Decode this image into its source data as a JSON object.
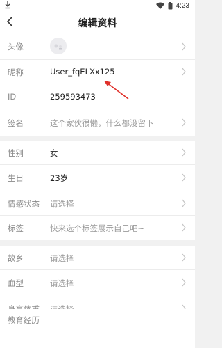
{
  "status_bar": {
    "time": "4:23"
  },
  "header": {
    "title": "编辑资料"
  },
  "rows": [
    {
      "label": "头像",
      "value": ""
    },
    {
      "label": "昵称",
      "value": "User_fqELXx125"
    },
    {
      "label": "ID",
      "value": "259593473"
    },
    {
      "label": "签名",
      "value": "这个家伙很懒，什么都没留下"
    },
    {
      "label": "性别",
      "value": "女"
    },
    {
      "label": "生日",
      "value": "23岁"
    },
    {
      "label": "情感状态",
      "value": "请选择"
    },
    {
      "label": "标签",
      "value": "快来选个标签展示自己吧~"
    },
    {
      "label": "故乡",
      "value": "请选择"
    },
    {
      "label": "血型",
      "value": "请选择"
    },
    {
      "label": "身高体重",
      "value": "请选择"
    },
    {
      "label": "教育经历",
      "value": ""
    }
  ],
  "colors": {
    "accent_arrow": "#e0302a",
    "background": "#f1f1f1"
  }
}
